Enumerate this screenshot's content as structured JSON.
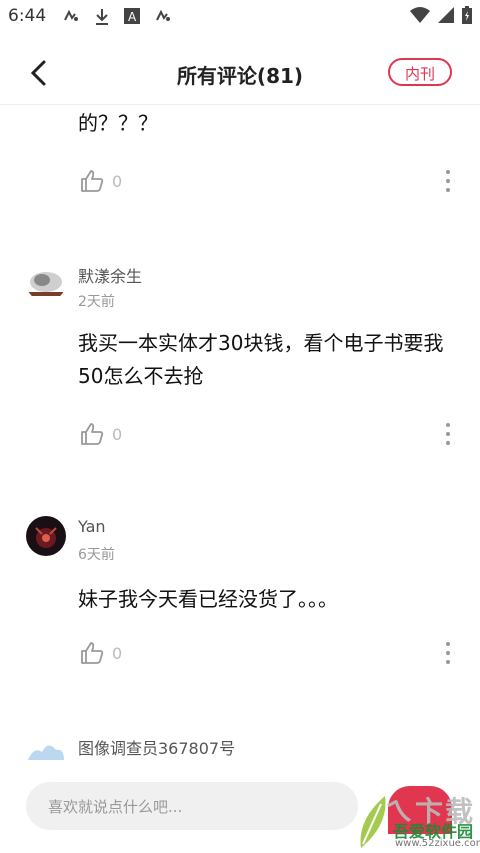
{
  "status_bar": {
    "time": "6:44"
  },
  "header": {
    "title": "所有评论(81)",
    "tag": "内刊"
  },
  "comments": [
    {
      "text": "的？？？",
      "likes": "0"
    },
    {
      "name": "默漾余生",
      "time": "2天前",
      "text": "我买一本实体才30块钱，看个电子书要我50怎么不去抢",
      "likes": "0"
    },
    {
      "name": "Yan",
      "time": "6天前",
      "text": "妹子我今天看已经没货了。。。",
      "likes": "0"
    },
    {
      "name": "图像调查员367807号"
    }
  ],
  "composer": {
    "placeholder": "喜欢就说点什么吧..."
  },
  "watermark": {
    "cn": "吾爱软件园",
    "url": "www.52zixue.com",
    "big": "ㄟ卞载"
  },
  "colors": {
    "accent": "#e0364f"
  }
}
